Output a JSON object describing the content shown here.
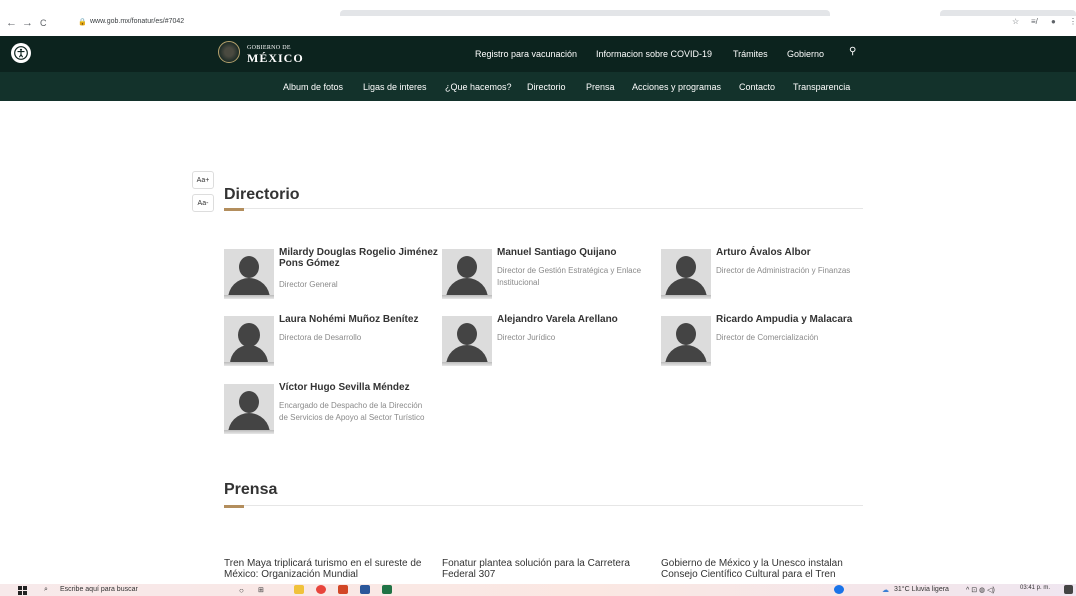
{
  "browser": {
    "back": "←",
    "forward": "→",
    "reload": "C",
    "lock": "🔒",
    "url": "www.gob.mx/fonatur/es/#7042",
    "star": "☆",
    "reading_list": "≡/",
    "profile": "●",
    "menu": "⋮"
  },
  "header": {
    "logo_small": "GOBIERNO DE",
    "logo_big": "MÉXICO",
    "top_links": [
      "Registro para vacunación",
      "Informacion sobre COVID-19",
      "Trámites",
      "Gobierno"
    ],
    "search_glyph": "⚲"
  },
  "subnav": {
    "items": [
      "Album de fotos",
      "Ligas de interes",
      "¿Que hacemos?",
      "Directorio",
      "Prensa",
      "Acciones y programas",
      "Contacto",
      "Transparencia"
    ]
  },
  "font_controls": {
    "increase": "Aa+",
    "decrease": "Aa-"
  },
  "directorio": {
    "title": "Directorio",
    "people": [
      {
        "name": "Milardy Douglas Rogelio Jiménez Pons Gómez",
        "role": "Director General"
      },
      {
        "name": "Manuel Santiago Quijano",
        "role": "Director de Gestión Estratégica y Enlace Institucional"
      },
      {
        "name": "Arturo Ávalos Albor",
        "role": "Director de Administración y Finanzas"
      },
      {
        "name": "Laura Nohémi Muñoz Benítez",
        "role": "Directora de Desarrollo"
      },
      {
        "name": "Alejandro Varela Arellano",
        "role": "Director Jurídico"
      },
      {
        "name": "Ricardo Ampudia y Malacara",
        "role": "Director de Comercialización"
      },
      {
        "name": "Víctor Hugo Sevilla Méndez",
        "role": "Encargado de Despacho de la Dirección de Servicios de Apoyo al Sector Turístico"
      }
    ]
  },
  "prensa": {
    "title": "Prensa",
    "news": [
      "Tren Maya triplicará turismo en el sureste de México: Organización Mundial",
      "Fonatur plantea solución para la Carretera Federal 307",
      "Gobierno de México y la Unesco instalan Consejo Científico Cultural para el Tren"
    ]
  },
  "taskbar": {
    "search_placeholder": "Escribe aquí para buscar",
    "weather": "31°C  Lluvia ligera",
    "tray": "^ ⊡ ◍ ◁)",
    "time": "03:41 p. m."
  },
  "colors": {
    "header_dark": "#0c231e",
    "subnav_green": "#13322b",
    "accent_gold": "#b38e5d"
  }
}
